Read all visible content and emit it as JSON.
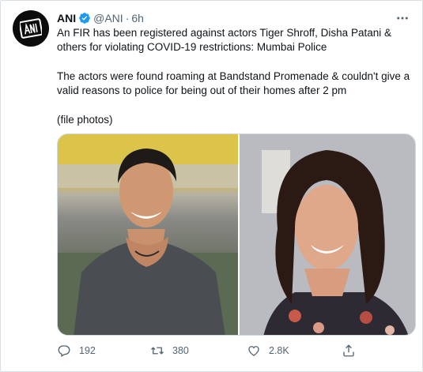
{
  "tweet": {
    "author": {
      "display_name": "ANI",
      "handle": "@ANI",
      "separator": "·",
      "time": "6h",
      "verified": true,
      "avatar_logo_text": "ANI"
    },
    "paragraphs": [
      "An FIR has been registered against actors Tiger Shroff, Disha Patani & others for violating COVID-19 restrictions: Mumbai Police",
      "The actors were found roaming at Bandstand Promenade & couldn't give a valid reasons to police for being out of their homes after 2 pm",
      "(file photos)"
    ],
    "media": {
      "photos": [
        {
          "alt": "photo of a man"
        },
        {
          "alt": "photo of a woman"
        }
      ]
    },
    "actions": {
      "reply": {
        "icon": "reply-icon",
        "count": "192"
      },
      "retweet": {
        "icon": "retweet-icon",
        "count": "380"
      },
      "like": {
        "icon": "like-icon",
        "count": "2.8K"
      },
      "share": {
        "icon": "share-icon"
      }
    }
  },
  "colors": {
    "accent": "#1d9bf0",
    "secondary_text": "#536471",
    "primary_text": "#0f1419",
    "border": "#cfd9de"
  }
}
